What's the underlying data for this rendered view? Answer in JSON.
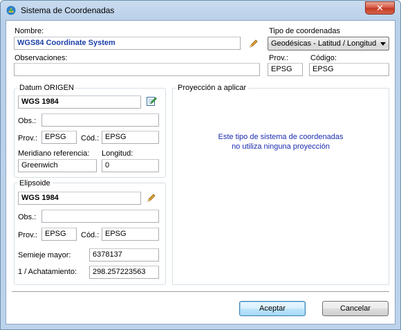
{
  "window": {
    "title": "Sistema de Coordenadas"
  },
  "top": {
    "nombre_label": "Nombre:",
    "nombre_value": "WGS84 Coordinate System",
    "tipo_label": "Tipo de coordenadas",
    "tipo_value": "Geodésicas - Latitud / Longitud",
    "observaciones_label": "Observaciones:",
    "observaciones_value": "",
    "prov_label": "Prov.:",
    "prov_value": "EPSG",
    "codigo_label": "Código:",
    "codigo_value": "EPSG"
  },
  "datum": {
    "group_title": "Datum ORIGEN",
    "name_value": "WGS 1984",
    "obs_label": "Obs.:",
    "obs_value": "",
    "prov_label": "Prov.:",
    "prov_value": "EPSG",
    "cod_label": "Cód.:",
    "cod_value": "EPSG",
    "meridiano_label": "Meridiano referencia:",
    "meridiano_value": "Greenwich",
    "longitud_label": "Longitud:",
    "longitud_value": "0"
  },
  "elipsoide": {
    "group_title": "Elipsoide",
    "name_value": "WGS 1984",
    "obs_label": "Obs.:",
    "obs_value": "",
    "prov_label": "Prov.:",
    "prov_value": "EPSG",
    "cod_label": "Cód.:",
    "cod_value": "EPSG",
    "semieje_label": "Semieje mayor:",
    "semieje_value": "6378137",
    "achatamiento_label": "1 / Achatamiento:",
    "achatamiento_value": "298.257223563"
  },
  "proyeccion": {
    "group_title": "Proyección a aplicar",
    "message_line1": "Este tipo de sistema de coordenadas",
    "message_line2": "no utiliza ninguna proyección"
  },
  "buttons": {
    "accept": "Aceptar",
    "cancel": "Cancelar"
  },
  "colors": {
    "accent_text": "#1b3fa6",
    "message_text": "#1b2bb0",
    "title_bar": "#c9dbef"
  }
}
